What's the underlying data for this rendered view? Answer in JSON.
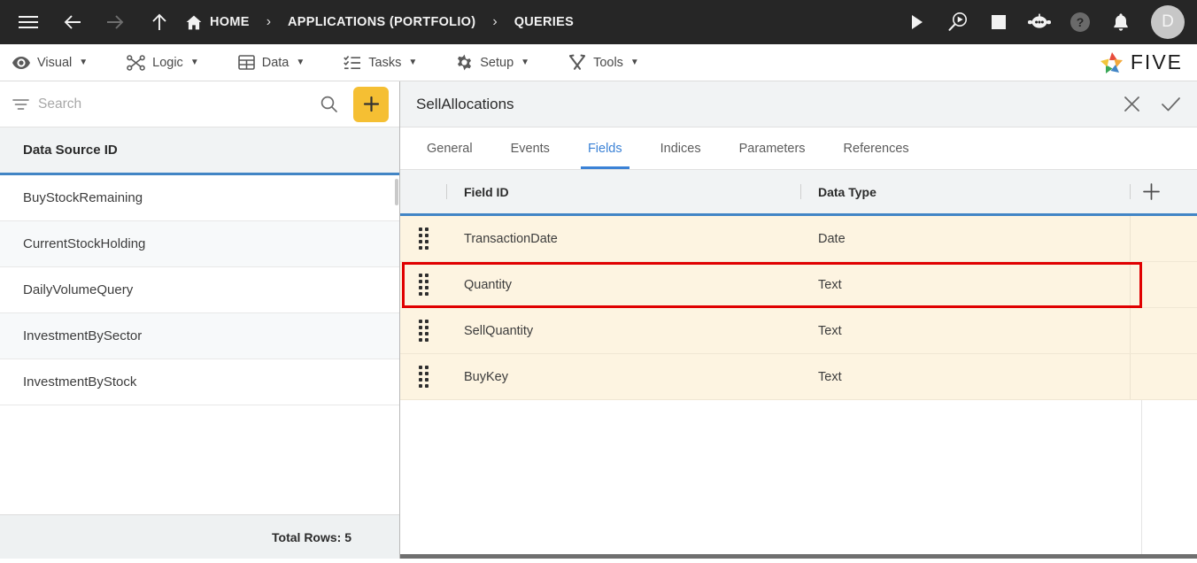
{
  "topbar": {
    "menu_icon": "hamburger-icon",
    "back_icon": "arrow-left-icon",
    "forward_icon": "arrow-right-icon",
    "up_icon": "arrow-up-icon",
    "home_icon": "home-icon",
    "breadcrumbs": [
      {
        "label": "HOME",
        "icon": "home-icon"
      },
      {
        "label": "APPLICATIONS (PORTFOLIO)",
        "icon": ""
      },
      {
        "label": "QUERIES",
        "icon": ""
      }
    ],
    "separator": "›",
    "actions": [
      {
        "name": "run-icon",
        "glyph": "play"
      },
      {
        "name": "debug-icon",
        "glyph": "magnify-play"
      },
      {
        "name": "stop-icon",
        "glyph": "square"
      },
      {
        "name": "assistant-icon",
        "glyph": "robot"
      },
      {
        "name": "help-icon",
        "glyph": "question-circle"
      },
      {
        "name": "notifications-icon",
        "glyph": "bell"
      }
    ],
    "avatar_initial": "D",
    "bar_color": "#262626",
    "accent_color": "#f7c948"
  },
  "menubar": {
    "items": [
      {
        "label": "Visual",
        "icon": "eye-icon",
        "caret": "▼"
      },
      {
        "label": "Logic",
        "icon": "flow-nodes-icon",
        "caret": "▼"
      },
      {
        "label": "Data",
        "icon": "table-grid-icon",
        "caret": "▼"
      },
      {
        "label": "Tasks",
        "icon": "checklist-icon",
        "caret": "▼"
      },
      {
        "label": "Setup",
        "icon": "gear-icon",
        "caret": "▼"
      },
      {
        "label": "Tools",
        "icon": "wrench-screwdriver-icon",
        "caret": "▼"
      }
    ],
    "logo_text": "FIVE",
    "logo_icon": "five-pinwheel-logo"
  },
  "sidebar": {
    "search": {
      "placeholder": "Search",
      "value": "",
      "filter_icon": "filter-icon",
      "search_icon": "search-icon",
      "add_label": "+",
      "add_icon": "plus-icon",
      "add_color": "#f5bf33"
    },
    "list_header": "Data Source ID",
    "items": [
      {
        "label": "BuyStockRemaining"
      },
      {
        "label": "CurrentStockHolding"
      },
      {
        "label": "DailyVolumeQuery"
      },
      {
        "label": "InvestmentBySector"
      },
      {
        "label": "InvestmentByStock"
      }
    ],
    "footer": "Total Rows: 5"
  },
  "detail": {
    "title": "SellAllocations",
    "close_icon": "close-icon",
    "confirm_icon": "check-icon",
    "tabs": [
      {
        "label": "General",
        "active": false
      },
      {
        "label": "Events",
        "active": false
      },
      {
        "label": "Fields",
        "active": true
      },
      {
        "label": "Indices",
        "active": false
      },
      {
        "label": "Parameters",
        "active": false
      },
      {
        "label": "References",
        "active": false
      }
    ],
    "grid": {
      "columns": [
        "Field ID",
        "Data Type"
      ],
      "add_column_icon": "plus-icon",
      "drag_handle_icon": "drag-dots-icon",
      "rows": [
        {
          "field_id": "TransactionDate",
          "data_type": "Date",
          "highlighted": false
        },
        {
          "field_id": "Quantity",
          "data_type": "Text",
          "highlighted": true
        },
        {
          "field_id": "SellQuantity",
          "data_type": "Text",
          "highlighted": false
        },
        {
          "field_id": "BuyKey",
          "data_type": "Text",
          "highlighted": false
        }
      ],
      "highlight_color": "#e00000",
      "row_color": "#fdf4e1",
      "header_underline_color": "#4285c5"
    }
  }
}
